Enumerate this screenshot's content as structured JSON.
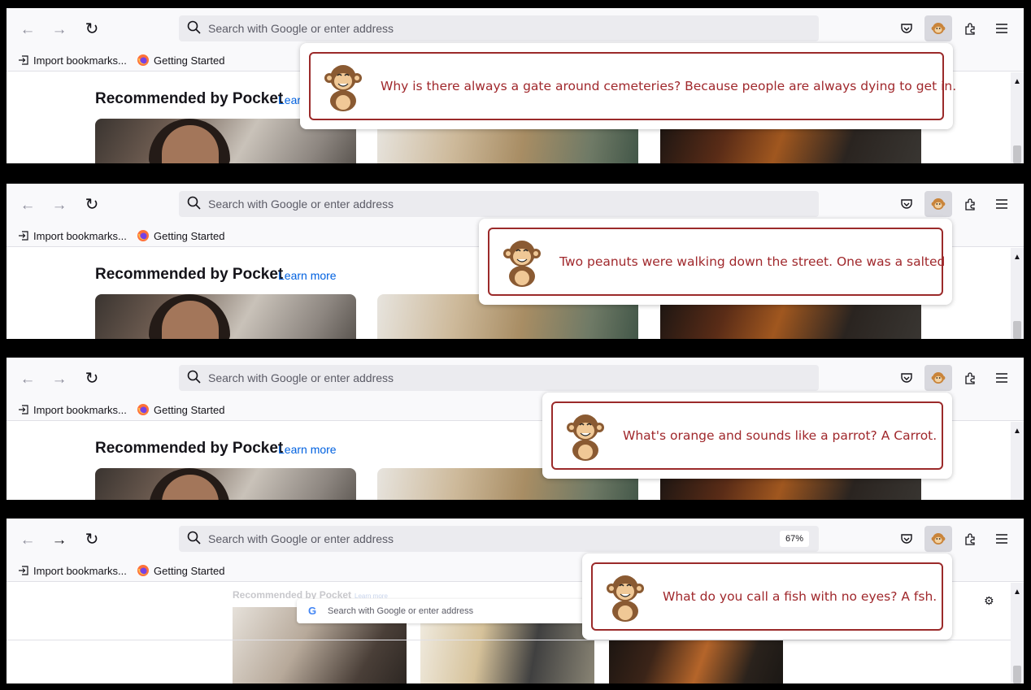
{
  "browser": {
    "url_placeholder": "Search with Google or enter address",
    "bookmarks": [
      "Import bookmarks...",
      "Getting Started"
    ],
    "section_title": "Recommended by Pocket",
    "learn_more": "Learn more",
    "learn_more_clipped": "Lear"
  },
  "panels": [
    {
      "joke": "Why is there always a gate around cemeteries? Because people are always dying to get in."
    },
    {
      "joke": "Two peanuts were walking down the street. One was a salted"
    },
    {
      "joke": "What's orange and sounds like a parrot? A Carrot."
    },
    {
      "joke": "What do you call a fish with no eyes? A fsh.",
      "zoom": "67%",
      "mini_search_placeholder": "Search with Google or enter address",
      "mini_title": "Recommended by Pocket",
      "mini_learn": "Learn more"
    }
  ],
  "icons": [
    "back-arrow-icon",
    "forward-arrow-icon",
    "reload-icon",
    "search-icon",
    "pocket-icon",
    "monkey-icon",
    "extensions-icon",
    "hamburger-menu-icon",
    "import-icon",
    "firefox-icon",
    "gear-icon"
  ],
  "colors": {
    "joke_text": "#a0282c",
    "joke_border": "#9b2a2a",
    "toolbar_bg": "#f9f9fb",
    "urlbar_bg": "#ebebef",
    "link": "#0061e0"
  }
}
